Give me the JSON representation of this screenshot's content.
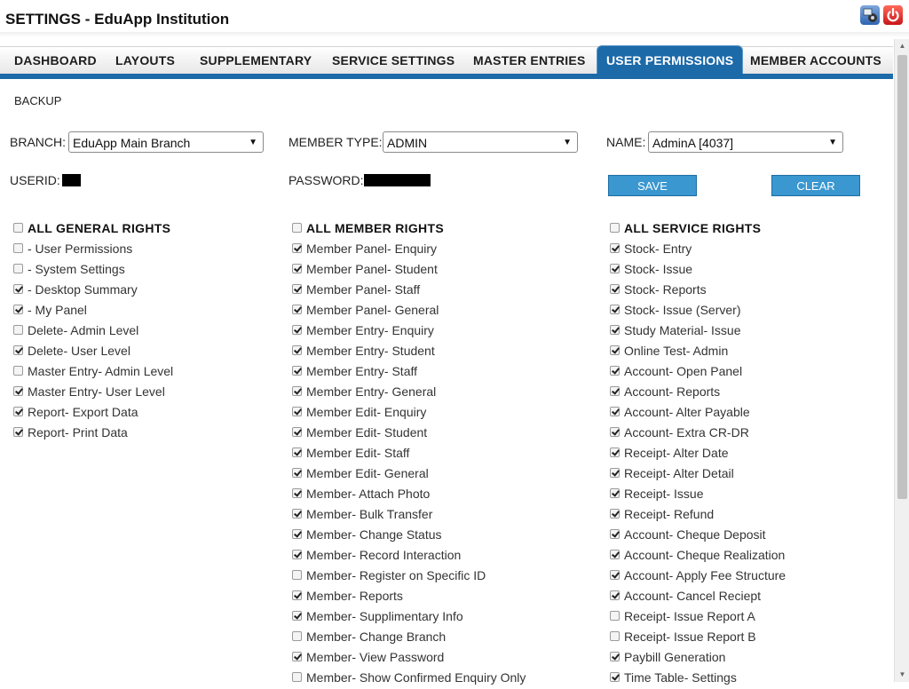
{
  "app": {
    "title": "SETTINGS - EduApp Institution"
  },
  "tabs": [
    {
      "label": "DASHBOARD"
    },
    {
      "label": "LAYOUTS"
    },
    {
      "label": "SUPPLEMENTARY"
    },
    {
      "label": "SERVICE SETTINGS"
    },
    {
      "label": "MASTER ENTRIES"
    },
    {
      "label": "USER PERMISSIONS"
    },
    {
      "label": "MEMBER ACCOUNTS"
    }
  ],
  "active_tab": "USER PERMISSIONS",
  "backup_label": "BACKUP",
  "form": {
    "branch_label": "BRANCH:",
    "branch_value": "EduApp Main Branch",
    "member_type_label": "MEMBER TYPE:",
    "member_type_value": "ADMIN",
    "name_label": "NAME:",
    "name_value": "AdminA [4037]",
    "userid_label": "USERID:",
    "password_label": "PASSWORD:",
    "save_label": "SAVE",
    "clear_label": "CLEAR"
  },
  "general_rights": {
    "header": "ALL GENERAL RIGHTS",
    "header_checked": false,
    "items": [
      {
        "label": "- User Permissions",
        "checked": false
      },
      {
        "label": "- System Settings",
        "checked": false
      },
      {
        "label": "- Desktop Summary",
        "checked": true
      },
      {
        "label": "- My Panel",
        "checked": true
      },
      {
        "label": "Delete- Admin Level",
        "checked": false
      },
      {
        "label": "Delete- User Level",
        "checked": true
      },
      {
        "label": "Master Entry- Admin Level",
        "checked": false
      },
      {
        "label": "Master Entry- User Level",
        "checked": true
      },
      {
        "label": "Report- Export Data",
        "checked": true
      },
      {
        "label": "Report- Print Data",
        "checked": true
      }
    ]
  },
  "member_rights": {
    "header": "ALL MEMBER RIGHTS",
    "header_checked": false,
    "items": [
      {
        "label": "Member Panel- Enquiry",
        "checked": true
      },
      {
        "label": "Member Panel- Student",
        "checked": true
      },
      {
        "label": "Member Panel- Staff",
        "checked": true
      },
      {
        "label": "Member Panel- General",
        "checked": true
      },
      {
        "label": "Member Entry- Enquiry",
        "checked": true
      },
      {
        "label": "Member Entry- Student",
        "checked": true
      },
      {
        "label": "Member Entry- Staff",
        "checked": true
      },
      {
        "label": "Member Entry- General",
        "checked": true
      },
      {
        "label": "Member Edit- Enquiry",
        "checked": true
      },
      {
        "label": "Member Edit- Student",
        "checked": true
      },
      {
        "label": "Member Edit- Staff",
        "checked": true
      },
      {
        "label": "Member Edit- General",
        "checked": true
      },
      {
        "label": "Member- Attach Photo",
        "checked": true
      },
      {
        "label": "Member- Bulk Transfer",
        "checked": true
      },
      {
        "label": "Member- Change Status",
        "checked": true
      },
      {
        "label": "Member- Record Interaction",
        "checked": true
      },
      {
        "label": "Member- Register on Specific ID",
        "checked": false
      },
      {
        "label": "Member- Reports",
        "checked": true
      },
      {
        "label": "Member- Supplimentary Info",
        "checked": true
      },
      {
        "label": "Member- Change Branch",
        "checked": false
      },
      {
        "label": "Member- View Password",
        "checked": true
      },
      {
        "label": "Member- Show Confirmed Enquiry Only",
        "checked": false
      }
    ]
  },
  "service_rights": {
    "header": "ALL SERVICE RIGHTS",
    "header_checked": false,
    "items": [
      {
        "label": "Stock- Entry",
        "checked": true
      },
      {
        "label": "Stock- Issue",
        "checked": true
      },
      {
        "label": "Stock- Reports",
        "checked": true
      },
      {
        "label": "Stock- Issue (Server)",
        "checked": true
      },
      {
        "label": "Study Material- Issue",
        "checked": true
      },
      {
        "label": "Online Test- Admin",
        "checked": true
      },
      {
        "label": "Account- Open Panel",
        "checked": true
      },
      {
        "label": "Account- Reports",
        "checked": true
      },
      {
        "label": "Account- Alter Payable",
        "checked": true
      },
      {
        "label": "Account- Extra CR-DR",
        "checked": true
      },
      {
        "label": "Receipt- Alter Date",
        "checked": true
      },
      {
        "label": "Receipt- Alter Detail",
        "checked": true
      },
      {
        "label": "Receipt- Issue",
        "checked": true
      },
      {
        "label": "Receipt- Refund",
        "checked": true
      },
      {
        "label": "Account- Cheque Deposit",
        "checked": true
      },
      {
        "label": "Account- Cheque Realization",
        "checked": true
      },
      {
        "label": "Account- Apply Fee Structure",
        "checked": true
      },
      {
        "label": "Account- Cancel Reciept",
        "checked": true
      },
      {
        "label": "Receipt- Issue Report A",
        "checked": false
      },
      {
        "label": "Receipt- Issue Report B",
        "checked": false
      },
      {
        "label": "Paybill Generation",
        "checked": true
      },
      {
        "label": "Time Table- Settings",
        "checked": true
      }
    ]
  },
  "icons": {
    "settings": "gear-icon",
    "power": "power-icon",
    "dropdown": "chevron-down-icon",
    "scroll_up": "scroll-up-arrow-icon",
    "scroll_down": "scroll-down-arrow-icon"
  },
  "colors": {
    "tab_active_bg": "#1d6aa9",
    "button_bg": "#3a97d0"
  }
}
